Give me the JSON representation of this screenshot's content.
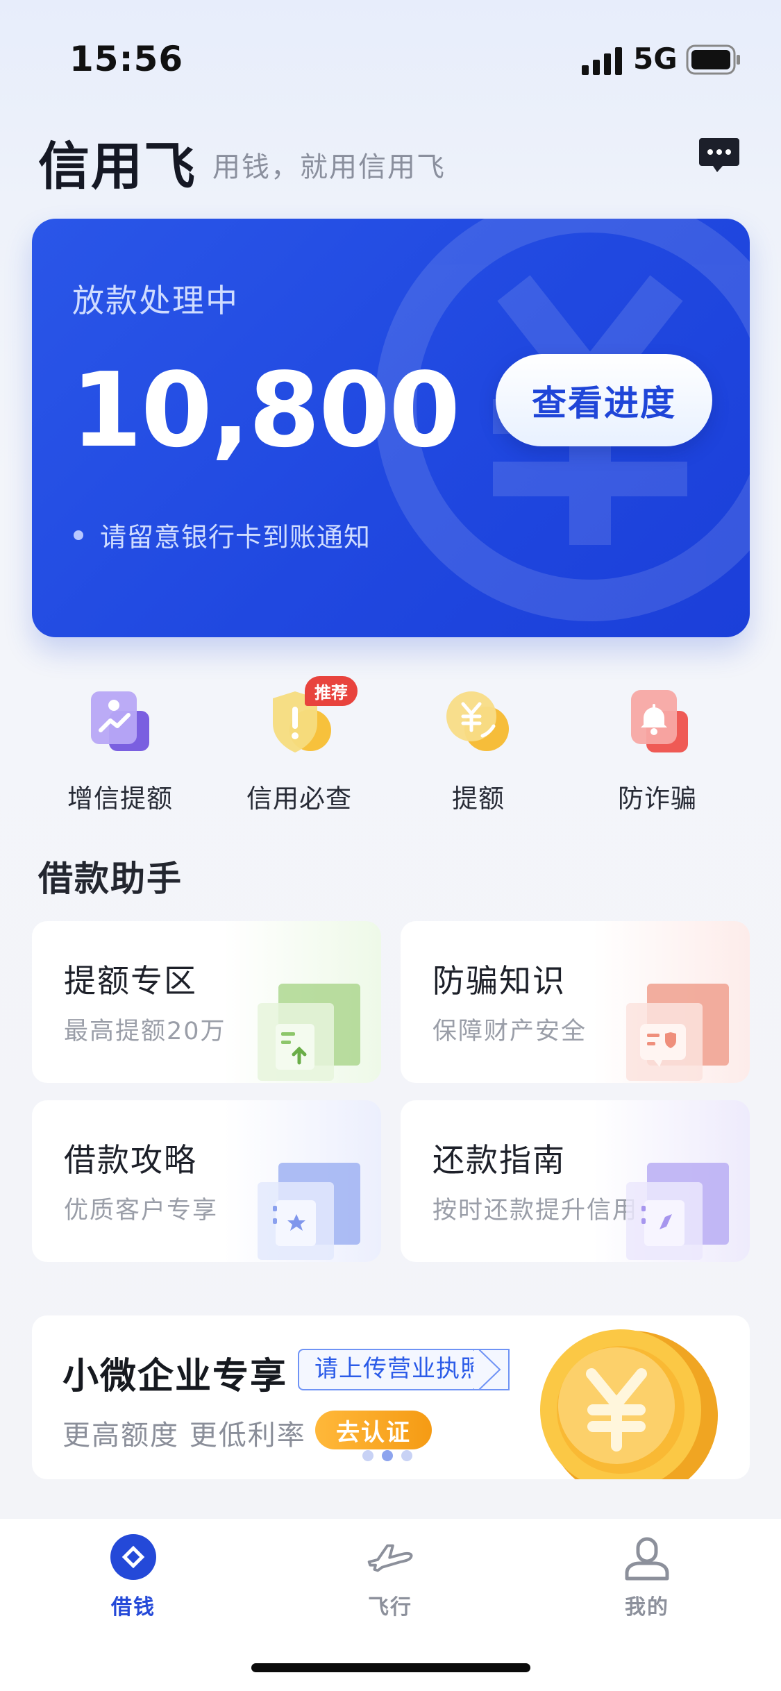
{
  "status_bar": {
    "time": "15:56",
    "network": "5G"
  },
  "header": {
    "brand": "信用飞",
    "slogan": "用钱，就用信用飞",
    "message_icon": "message-icon"
  },
  "loan_card": {
    "status": "放款处理中",
    "amount": "10,800",
    "button": "查看进度",
    "note": "请留意银行卡到账通知",
    "colors": {
      "start": "#2a56e8",
      "end": "#1b3fd9"
    }
  },
  "quick_actions": [
    {
      "label": "增信提额",
      "icon": "credit-boost-icon"
    },
    {
      "label": "信用必查",
      "icon": "credit-check-icon",
      "badge": "推荐"
    },
    {
      "label": "提额",
      "icon": "yuan-coin-icon"
    },
    {
      "label": "防诈骗",
      "icon": "bell-alert-icon"
    }
  ],
  "assistant": {
    "title": "借款助手",
    "tiles": [
      {
        "title": "提额专区",
        "subtitle": "最高提额20万",
        "icon": "upload-document-icon"
      },
      {
        "title": "防骗知识",
        "subtitle": "保障财产安全",
        "icon": "shield-message-icon"
      },
      {
        "title": "借款攻略",
        "subtitle": "优质客户专享",
        "icon": "star-book-icon"
      },
      {
        "title": "还款指南",
        "subtitle": "按时还款提升信用",
        "icon": "compass-book-icon"
      }
    ]
  },
  "promo": {
    "title": "小微企业专享",
    "tag": "请上传营业执照",
    "subtitle": "更高额度 更低利率",
    "button": "去认证",
    "icon": "gold-coin-icon"
  },
  "tabbar": [
    {
      "label": "借钱",
      "icon": "diamond-icon",
      "active": true
    },
    {
      "label": "飞行",
      "icon": "airplane-icon",
      "active": false
    },
    {
      "label": "我的",
      "icon": "user-icon",
      "active": false
    }
  ]
}
